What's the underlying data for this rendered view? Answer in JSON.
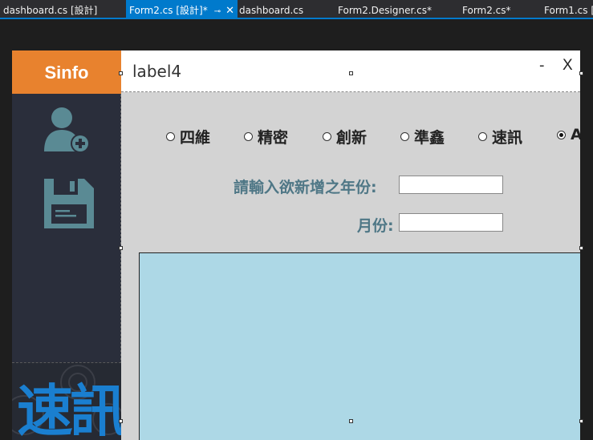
{
  "tabs": [
    {
      "label": "dashboard.cs [設計]",
      "active": false
    },
    {
      "label": "Form2.cs [設計]*",
      "active": true
    },
    {
      "label": "dashboard.cs",
      "active": false
    },
    {
      "label": "Form2.Designer.cs*",
      "active": false
    },
    {
      "label": "Form2.cs*",
      "active": false
    },
    {
      "label": "Form1.cs [設",
      "active": false
    }
  ],
  "tab_pin_glyph": "⊸",
  "tab_close_glyph": "✕",
  "form": {
    "logo_text": "Sinfo",
    "title_label": "label4",
    "minimize_glyph": "-",
    "close_glyph": "X",
    "sidebar_icons": [
      "add-user-icon",
      "save-icon"
    ],
    "brand_text": "速訊",
    "radio_options": [
      {
        "label": "四維",
        "checked": false
      },
      {
        "label": "精密",
        "checked": false
      },
      {
        "label": "創新",
        "checked": false
      },
      {
        "label": "準鑫",
        "checked": false
      },
      {
        "label": "速訊",
        "checked": false
      },
      {
        "label": "A",
        "checked": true
      }
    ],
    "year_label": "請輸入欲新增之年份:",
    "year_value": "",
    "month_label": "月份:",
    "month_value": ""
  },
  "colors": {
    "accent_tab": "#007acc",
    "logo_bg": "#e8822e",
    "sidebar_bg": "#2a2e3b",
    "form_bg": "#d3d3d3",
    "panel_bg": "#add8e6",
    "label_color": "#4f7786",
    "icon_color": "#5a8a94"
  }
}
